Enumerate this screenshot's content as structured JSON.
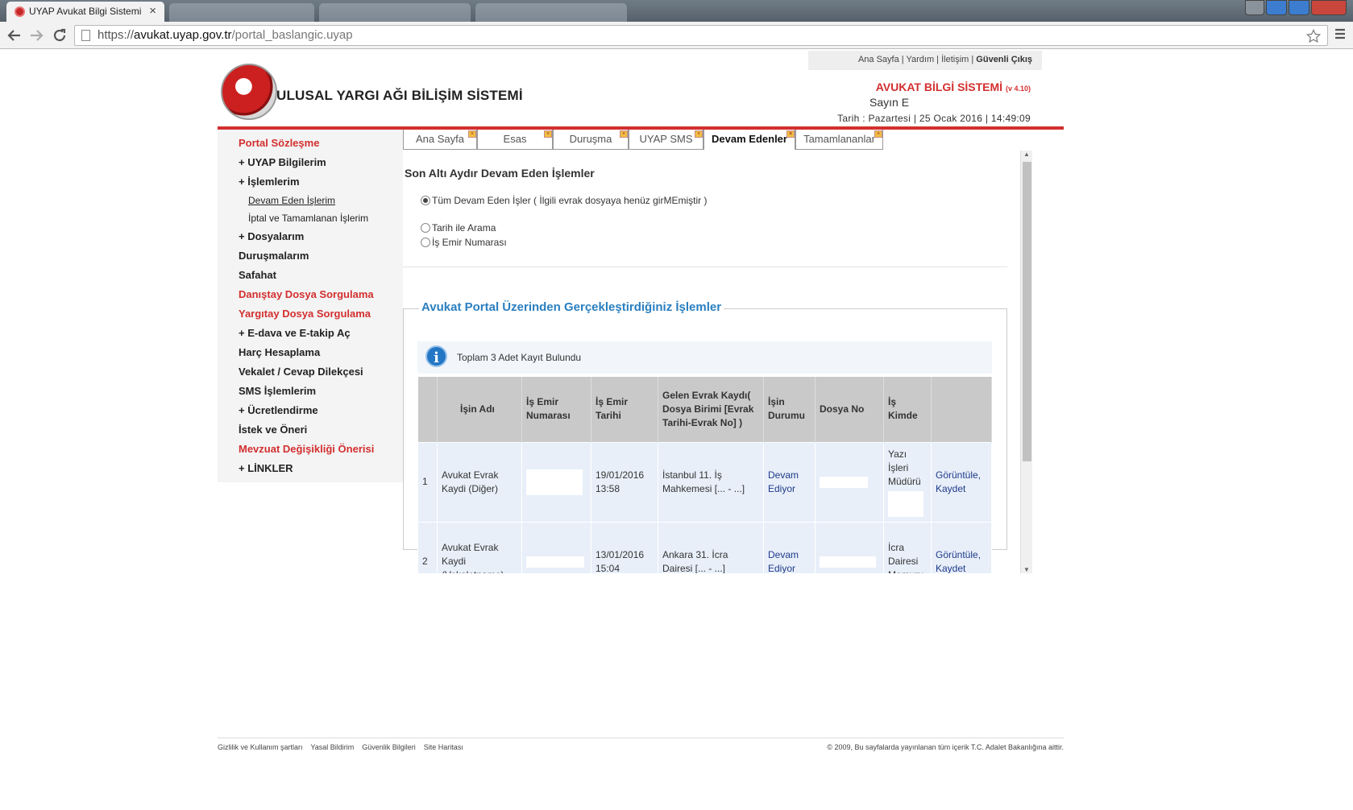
{
  "browser": {
    "tab_title": "UYAP Avukat Bilgi Sistemi",
    "close_glyph": "×",
    "url_scheme": "https://",
    "url_host": "avukat.uyap.gov.tr",
    "url_path": "/portal_baslangic.uyap",
    "back_icon": "arrow-left-icon",
    "forward_icon": "arrow-right-icon",
    "reload_icon": "reload-icon"
  },
  "header": {
    "toplinks": "Ana Sayfa | Yardım | İletişim | ",
    "logout": "Güvenli Çıkış",
    "logo_text": "ULUSAL YARGI AĞI BİLİŞİM SİSTEMİ",
    "system_name": "AVUKAT BİLGİ SİSTEMİ",
    "version": "(v 4.10)",
    "user": "Sayın E",
    "date": "Tarih : Pazartesi | 25 Ocak 2016 | 14:49:09"
  },
  "sidebar": {
    "items": [
      {
        "label": "Portal Sözleşme"
      },
      {
        "label": "+ UYAP Bilgilerim"
      },
      {
        "label": "+ İşlemlerim"
      },
      {
        "label": "Devam Eden İşlerim"
      },
      {
        "label": "İptal ve Tamamlanan İşlerim"
      },
      {
        "label": "+ Dosyalarım"
      },
      {
        "label": "Duruşmalarım"
      },
      {
        "label": "Safahat"
      },
      {
        "label": "Danıştay Dosya Sorgulama"
      },
      {
        "label": "Yargıtay Dosya Sorgulama"
      },
      {
        "label": "+ E-dava ve E-takip Aç"
      },
      {
        "label": "Harç Hesaplama"
      },
      {
        "label": "Vekalet / Cevap Dilekçesi"
      },
      {
        "label": "SMS İşlemlerim"
      },
      {
        "label": "+ Ücretlendirme"
      },
      {
        "label": "İstek ve Öneri"
      },
      {
        "label": "Mevzuat Değişikliği Önerisi"
      },
      {
        "label": "+ LİNKLER"
      }
    ]
  },
  "tabs": [
    "Ana Sayfa",
    "Esas",
    "Duruşma",
    "UYAP SMS",
    "Devam Edenler",
    "Tamamlananlar"
  ],
  "tab_close_glyph": "×",
  "content": {
    "title": "Son Altı Aydır Devam Eden İşlemler",
    "radio1": "Tüm Devam Eden İşler  ( İlgili evrak dosyaya henüz girMEmiştir )",
    "radio2": "Tarih ile Arama",
    "radio3": "İş Emir Numarası",
    "section_title": "Avukat Portal Üzerinden Gerçekleştirdiğiniz İşlemler",
    "info_glyph": "i",
    "info": "Toplam 3 Adet Kayıt Bulundu",
    "table": {
      "headers": [
        "",
        "İşin Adı",
        "İş Emir Numarası",
        "İş Emir Tarihi",
        "Gelen Evrak Kaydı( Dosya Birimi [Evrak Tarihi-Evrak No] )",
        "İşin Durumu",
        "Dosya No",
        "İş Kimde",
        ""
      ],
      "rows": [
        [
          "1",
          "Avukat Evrak Kaydi (Diğer)",
          "",
          "19/01/2016 13:58",
          "İstanbul 11. İş Mahkemesi [... - ...]",
          "Devam Ediyor",
          "",
          "Yazı İşleri Müdürü",
          "Görüntüle, Kaydet"
        ],
        [
          "2",
          "Avukat Evrak Kaydi (Vekaletname)",
          "",
          "13/01/2016 15:04",
          "Ankara 31. İcra Dairesi [... - ...]",
          "Devam Ediyor",
          "",
          "İcra Dairesi Memuru",
          "Görüntüle, Kaydet"
        ]
      ]
    }
  },
  "scrollbar": {
    "up_glyph": "▲",
    "down_glyph": "▼"
  },
  "footer": {
    "links": [
      "Gizlilik ve Kullanım şartları",
      "Yasal Bildirim",
      "Güvenlik Bilgileri",
      "Site Haritası"
    ],
    "copyright": "© 2009, Bu sayfalarda yayınlanan tüm içerik T.C. Adalet Bakanlığına aittir."
  }
}
